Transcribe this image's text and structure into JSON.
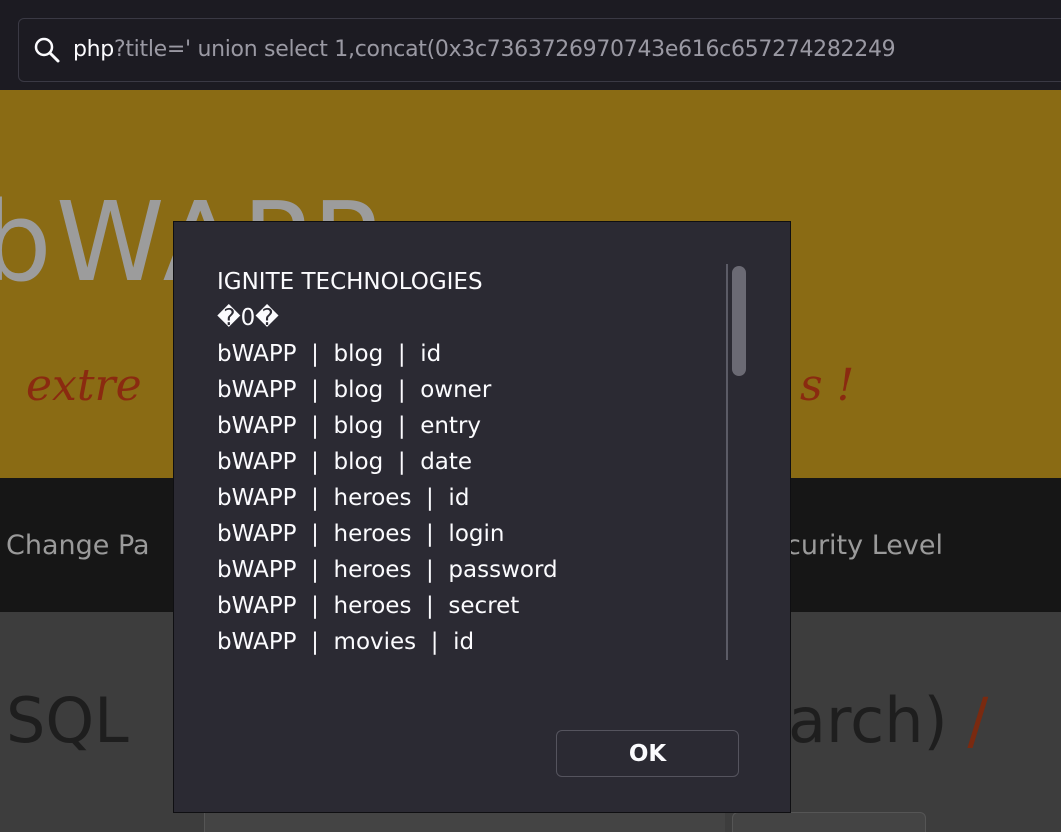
{
  "urlbar": {
    "host": "php",
    "query": "?title=' union select 1,concat(0x3c7363726970743e616c657274282249"
  },
  "page": {
    "logo": "bWAPP",
    "tagline_left": "extre",
    "tagline_right": "s !",
    "nav": [
      "Change Pa",
      "curity Level"
    ],
    "heading_left": "SQL",
    "heading_right": "arch)",
    "heading_slash": " /"
  },
  "dialog": {
    "lines": [
      "IGNITE TECHNOLOGIES",
      "�0�",
      "bWAPP  |  blog  |  id",
      "bWAPP  |  blog  |  owner",
      "bWAPP  |  blog  |  entry",
      "bWAPP  |  blog  |  date",
      "bWAPP  |  heroes  |  id",
      "bWAPP  |  heroes  |  login",
      "bWAPP  |  heroes  |  password",
      "bWAPP  |  heroes  |  secret",
      "bWAPP  |  movies  |  id"
    ],
    "ok_label": "OK"
  },
  "colors": {
    "banner": "#8a6b14",
    "dialog_bg": "#2b2a33",
    "text": "#fbfbfe"
  }
}
